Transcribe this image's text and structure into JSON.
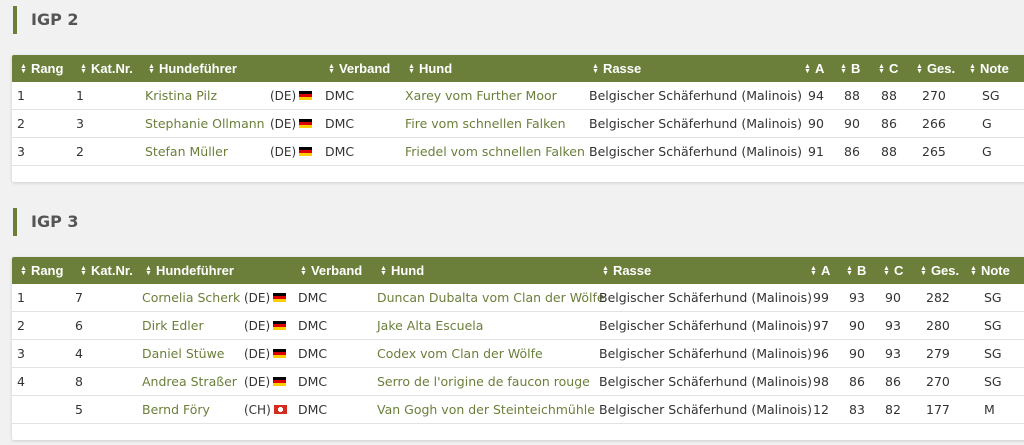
{
  "sections": [
    {
      "title": "IGP 2",
      "headers": [
        "Rang",
        "Kat.Nr.",
        "Hundeführer",
        "Verband",
        "Hund",
        "Rasse",
        "A",
        "B",
        "C",
        "Ges.",
        "Note"
      ],
      "rows": [
        {
          "rang": "1",
          "katnr": "1",
          "handler": "Kristina Pilz",
          "country": "(DE)",
          "flag": "DE",
          "verband": "DMC",
          "hund": "Xarey vom Further Moor",
          "rasse": "Belgischer Schäferhund (Malinois)",
          "a": "94",
          "b": "88",
          "c": "88",
          "ges": "270",
          "note": "SG"
        },
        {
          "rang": "2",
          "katnr": "3",
          "handler": "Stephanie Ollmann",
          "country": "(DE)",
          "flag": "DE",
          "verband": "DMC",
          "hund": "Fire vom schnellen Falken",
          "rasse": "Belgischer Schäferhund (Malinois)",
          "a": "90",
          "b": "90",
          "c": "86",
          "ges": "266",
          "note": "G"
        },
        {
          "rang": "3",
          "katnr": "2",
          "handler": "Stefan Müller",
          "country": "(DE)",
          "flag": "DE",
          "verband": "DMC",
          "hund": "Friedel vom schnellen Falken",
          "rasse": "Belgischer Schäferhund (Malinois)",
          "a": "91",
          "b": "86",
          "c": "88",
          "ges": "265",
          "note": "G"
        }
      ]
    },
    {
      "title": "IGP 3",
      "headers": [
        "Rang",
        "Kat.Nr.",
        "Hundeführer",
        "Verband",
        "Hund",
        "Rasse",
        "A",
        "B",
        "C",
        "Ges.",
        "Note"
      ],
      "rows": [
        {
          "rang": "1",
          "katnr": "7",
          "handler": "Cornelia Scherk",
          "country": "(DE)",
          "flag": "DE",
          "verband": "DMC",
          "hund": "Duncan Dubalta vom Clan der Wölfe",
          "rasse": "Belgischer Schäferhund (Malinois)",
          "a": "99",
          "b": "93",
          "c": "90",
          "ges": "282",
          "note": "SG"
        },
        {
          "rang": "2",
          "katnr": "6",
          "handler": "Dirk Edler",
          "country": "(DE)",
          "flag": "DE",
          "verband": "DMC",
          "hund": "Jake Alta Escuela",
          "rasse": "Belgischer Schäferhund (Malinois)",
          "a": "97",
          "b": "90",
          "c": "93",
          "ges": "280",
          "note": "SG"
        },
        {
          "rang": "3",
          "katnr": "4",
          "handler": "Daniel Stüwe",
          "country": "(DE)",
          "flag": "DE",
          "verband": "DMC",
          "hund": "Codex vom Clan der Wölfe",
          "rasse": "Belgischer Schäferhund (Malinois)",
          "a": "96",
          "b": "90",
          "c": "93",
          "ges": "279",
          "note": "SG"
        },
        {
          "rang": "4",
          "katnr": "8",
          "handler": "Andrea Straßer",
          "country": "(DE)",
          "flag": "DE",
          "verband": "DMC",
          "hund": "Serro de l'origine de faucon rouge",
          "rasse": "Belgischer Schäferhund (Malinois)",
          "a": "98",
          "b": "86",
          "c": "86",
          "ges": "270",
          "note": "SG"
        },
        {
          "rang": "",
          "katnr": "5",
          "handler": "Bernd Föry",
          "country": "(CH)",
          "flag": "CH",
          "verband": "DMC",
          "hund": "Van Gogh von der Steinteichmühle",
          "rasse": "Belgischer Schäferhund (Malinois)",
          "a": "12",
          "b": "83",
          "c": "82",
          "ges": "177",
          "note": "M"
        }
      ]
    }
  ]
}
